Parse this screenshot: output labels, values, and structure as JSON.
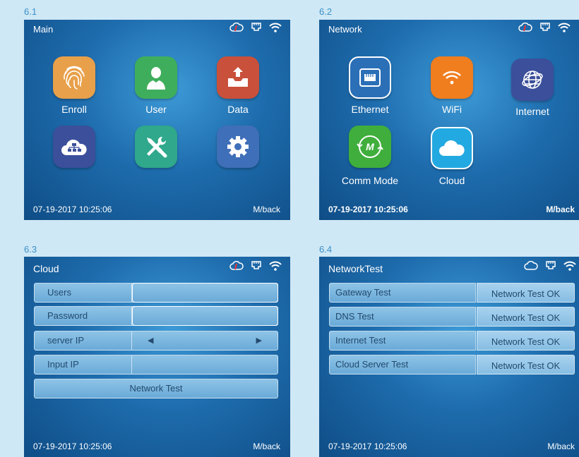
{
  "labels": {
    "p1": "6.1",
    "p2": "6.2",
    "p3": "6.3",
    "p4": "6.4"
  },
  "footer": {
    "datetime": "07-19-2017 10:25:06",
    "back": "M/back"
  },
  "panel1": {
    "title": "Main",
    "apps": [
      {
        "label": "Enroll",
        "icon": "fingerprint-icon",
        "color": "#e8a04a"
      },
      {
        "label": "User",
        "icon": "user-icon",
        "color": "#3fae5c"
      },
      {
        "label": "Data",
        "icon": "data-icon",
        "color": "#c9503a"
      },
      {
        "label": "",
        "icon": "network-cloud-icon",
        "color": "#3b4f9a"
      },
      {
        "label": "",
        "icon": "tools-icon",
        "color": "#2fa88b"
      },
      {
        "label": "",
        "icon": "gear-icon",
        "color": "#3f6fb8"
      }
    ]
  },
  "panel2": {
    "title": "Network",
    "apps": [
      {
        "label": "Ethernet",
        "icon": "ethernet-icon",
        "color": "#2b6fb7"
      },
      {
        "label": "WiFi",
        "icon": "wifi-icon",
        "color": "#f07d1e"
      },
      {
        "label": "Internet",
        "icon": "globe-icon",
        "color": "#3b4f9a"
      },
      {
        "label": "Comm Mode",
        "icon": "comm-mode-icon",
        "color": "#3fae3c"
      },
      {
        "label": "Cloud",
        "icon": "cloud-icon",
        "color": "#23a9e1"
      }
    ]
  },
  "panel3": {
    "title": "Cloud",
    "rows": [
      {
        "label": "Users",
        "value": ""
      },
      {
        "label": "Password",
        "value": ""
      },
      {
        "label": "server IP",
        "value": ""
      },
      {
        "label": "Input IP",
        "value": ""
      }
    ],
    "button": "Network Test"
  },
  "panel4": {
    "title": "NetworkTest",
    "rows": [
      {
        "label": "Gateway Test",
        "value": "Network Test OK"
      },
      {
        "label": "DNS Test",
        "value": "Network Test OK"
      },
      {
        "label": "Internet Test",
        "value": "Network Test OK"
      },
      {
        "label": "Cloud Server Test",
        "value": "Network Test OK"
      }
    ]
  }
}
